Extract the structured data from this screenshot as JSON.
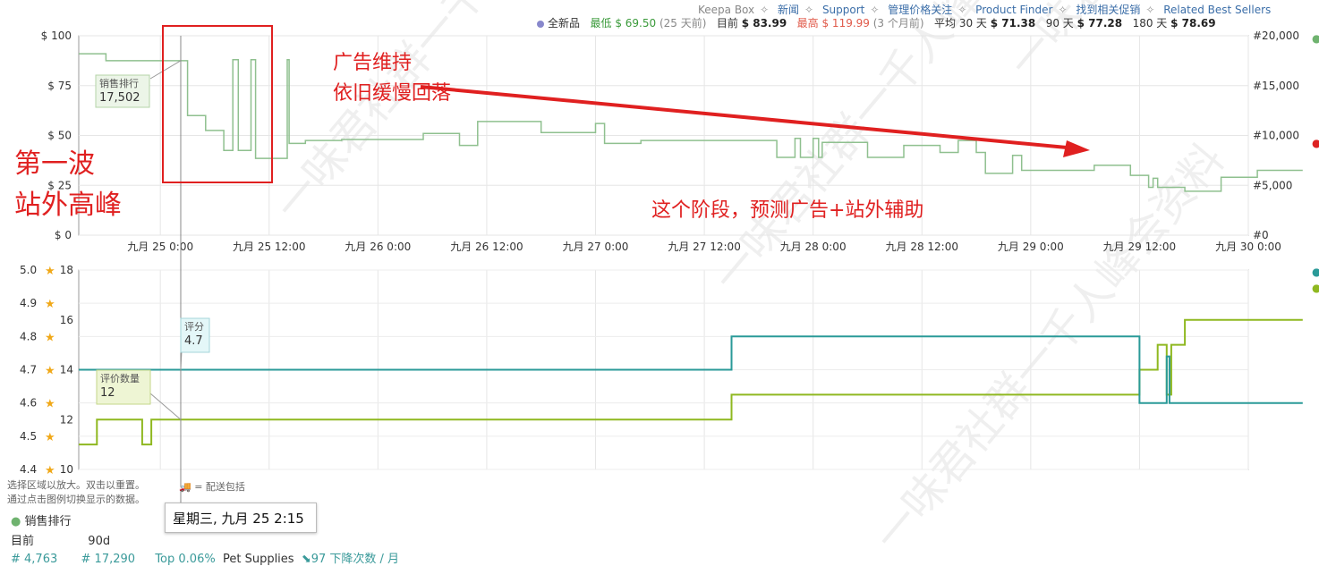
{
  "header": {
    "nav_items": [
      "Keepa Box",
      "新闻",
      "Support",
      "管理价格关注",
      "Product Finder",
      "找到相关促销",
      "Related Best Sellers"
    ],
    "new_label": "全新品",
    "low_label": "最低",
    "low_value": "$ 69.50",
    "low_when": "(25 天前)",
    "current_label": "目前",
    "current_value": "$ 83.99",
    "high_label": "最高",
    "high_value": "$ 119.99",
    "high_when": "(3 个月前)",
    "avg30_label": "平均 30 天",
    "avg30_value": "$ 71.38",
    "avg90_label": "90 天",
    "avg90_value": "$ 77.28",
    "avg180_label": "180 天",
    "avg180_value": "$ 78.69"
  },
  "chart_data": [
    {
      "type": "line",
      "y_left_ticks": [
        "$ 100",
        "$ 75",
        "$ 50",
        "$ 25",
        "$ 0"
      ],
      "y_right_ticks": [
        "#20,000",
        "#15,000",
        "#10,000",
        "#5,000",
        "#0"
      ],
      "x_ticks": [
        "九月 25 0:00",
        "九月 25 12:00",
        "九月 26 0:00",
        "九月 26 12:00",
        "九月 27 0:00",
        "九月 27 12:00",
        "九月 28 0:00",
        "九月 28 12:00",
        "九月 29 0:00",
        "九月 29 12:00",
        "九月 30 0:00"
      ],
      "ylim_left": [
        0,
        100
      ],
      "ylim_right": [
        0,
        20000
      ],
      "xlim_hours": [
        -9,
        120
      ],
      "grid": true,
      "series": [
        {
          "name": "销售排行",
          "color": "#8fc08f",
          "axis": "right",
          "points": [
            [
              -9,
              18200
            ],
            [
              -6,
              18200
            ],
            [
              -6,
              17502
            ],
            [
              3,
              17502
            ],
            [
              3,
              12000
            ],
            [
              5,
              12000
            ],
            [
              5,
              10500
            ],
            [
              7,
              10500
            ],
            [
              7,
              8500
            ],
            [
              8,
              8500
            ],
            [
              8,
              17600
            ],
            [
              8.6,
              17600
            ],
            [
              8.6,
              8500
            ],
            [
              10,
              8500
            ],
            [
              10,
              17600
            ],
            [
              10.5,
              17600
            ],
            [
              10.5,
              7700
            ],
            [
              14,
              7700
            ],
            [
              14,
              17600
            ],
            [
              14.2,
              17600
            ],
            [
              14.2,
              9200
            ],
            [
              16,
              9200
            ],
            [
              16,
              9500
            ],
            [
              20,
              9500
            ],
            [
              20,
              9600
            ],
            [
              29,
              9600
            ],
            [
              29,
              10200
            ],
            [
              33,
              10200
            ],
            [
              33,
              9000
            ],
            [
              35,
              9000
            ],
            [
              35,
              11400
            ],
            [
              42,
              11400
            ],
            [
              42,
              10300
            ],
            [
              48,
              10300
            ],
            [
              48,
              11200
            ],
            [
              49,
              11200
            ],
            [
              49,
              9200
            ],
            [
              53,
              9200
            ],
            [
              53,
              9500
            ],
            [
              68,
              9500
            ],
            [
              68,
              7800
            ],
            [
              70,
              7800
            ],
            [
              70,
              9700
            ],
            [
              70.6,
              9700
            ],
            [
              70.6,
              7800
            ],
            [
              72,
              7800
            ],
            [
              72,
              9700
            ],
            [
              72.6,
              9700
            ],
            [
              72.6,
              7800
            ],
            [
              73,
              7800
            ],
            [
              73,
              9300
            ],
            [
              78,
              9300
            ],
            [
              78,
              7800
            ],
            [
              82,
              7800
            ],
            [
              82,
              9000
            ],
            [
              86,
              9000
            ],
            [
              86,
              8300
            ],
            [
              88,
              8300
            ],
            [
              88,
              9500
            ],
            [
              90,
              9500
            ],
            [
              90,
              8300
            ],
            [
              91,
              8300
            ],
            [
              91,
              6200
            ],
            [
              94,
              6200
            ],
            [
              94,
              8000
            ],
            [
              95,
              8000
            ],
            [
              95,
              6500
            ],
            [
              103,
              6500
            ],
            [
              103,
              7000
            ],
            [
              107,
              7000
            ],
            [
              107,
              6000
            ],
            [
              109,
              6000
            ],
            [
              109,
              4800
            ],
            [
              109.5,
              4800
            ],
            [
              109.5,
              5700
            ],
            [
              110,
              5700
            ],
            [
              110,
              4800
            ],
            [
              113,
              4800
            ],
            [
              113,
              4400
            ],
            [
              117,
              4400
            ],
            [
              117,
              5800
            ],
            [
              121,
              5800
            ],
            [
              121,
              6500
            ],
            [
              126,
              6500
            ]
          ]
        }
      ],
      "annotations": [
        {
          "label": "销售排行",
          "value": "17,502"
        },
        {
          "text": "广告维持"
        },
        {
          "text": "依旧缓慢回落"
        },
        {
          "text": "第一波"
        },
        {
          "text": "站外高峰"
        },
        {
          "text": "这个阶段，预测广告+站外辅助"
        }
      ]
    },
    {
      "type": "line",
      "y_left_ticks": [
        "5.0",
        "4.9",
        "4.8",
        "4.7",
        "4.6",
        "4.5",
        "4.4"
      ],
      "y_mid_ticks": [
        "18",
        "16",
        "14",
        "12",
        "10"
      ],
      "ylim_rating": [
        4.4,
        5.0
      ],
      "ylim_count": [
        10,
        18
      ],
      "xlim_hours": [
        -9,
        120
      ],
      "grid": true,
      "series": [
        {
          "name": "评分",
          "color": "#2a9a98",
          "axis": "rating",
          "points": [
            [
              -9,
              4.7
            ],
            [
              63,
              4.7
            ],
            [
              63,
              4.8
            ],
            [
              108,
              4.8
            ],
            [
              108,
              4.6
            ],
            [
              111,
              4.6
            ],
            [
              111,
              4.74
            ],
            [
              111.3,
              4.74
            ],
            [
              111.3,
              4.6
            ],
            [
              126,
              4.6
            ]
          ]
        },
        {
          "name": "评价数量",
          "color": "#8fb820",
          "axis": "count",
          "points": [
            [
              -9,
              11
            ],
            [
              -7,
              11
            ],
            [
              -7,
              12
            ],
            [
              -2,
              12
            ],
            [
              -2,
              11
            ],
            [
              -1,
              11
            ],
            [
              -1,
              12
            ],
            [
              63,
              12
            ],
            [
              63,
              13
            ],
            [
              108,
              13
            ],
            [
              108,
              14
            ],
            [
              110,
              14
            ],
            [
              110,
              15
            ],
            [
              111,
              15
            ],
            [
              111,
              13
            ],
            [
              111.5,
              13
            ],
            [
              111.5,
              15
            ],
            [
              113,
              15
            ],
            [
              113,
              16
            ],
            [
              126,
              16
            ]
          ]
        }
      ],
      "annotations": [
        {
          "label": "评分",
          "value": "4.7"
        },
        {
          "label": "评价数量",
          "value": "12"
        }
      ]
    }
  ],
  "footer": {
    "hint_line1": "选择区域以放大。双击以重置。",
    "hint_line2": "通过点击图例切换显示的数据。",
    "truck_label": "= 配送包括",
    "tooltip": "星期三, 九月 25 2:15",
    "legend_sales": "销售排行",
    "current_label": "目前",
    "period_label": "90d",
    "current_rank": "# 4,763",
    "period_rank": "# 17,290",
    "top_pct": "Top 0.06%",
    "category": "Pet Supplies",
    "drop_text": "97 下降次数 / 月"
  },
  "watermark": "一味君社群一千人峰会资料"
}
